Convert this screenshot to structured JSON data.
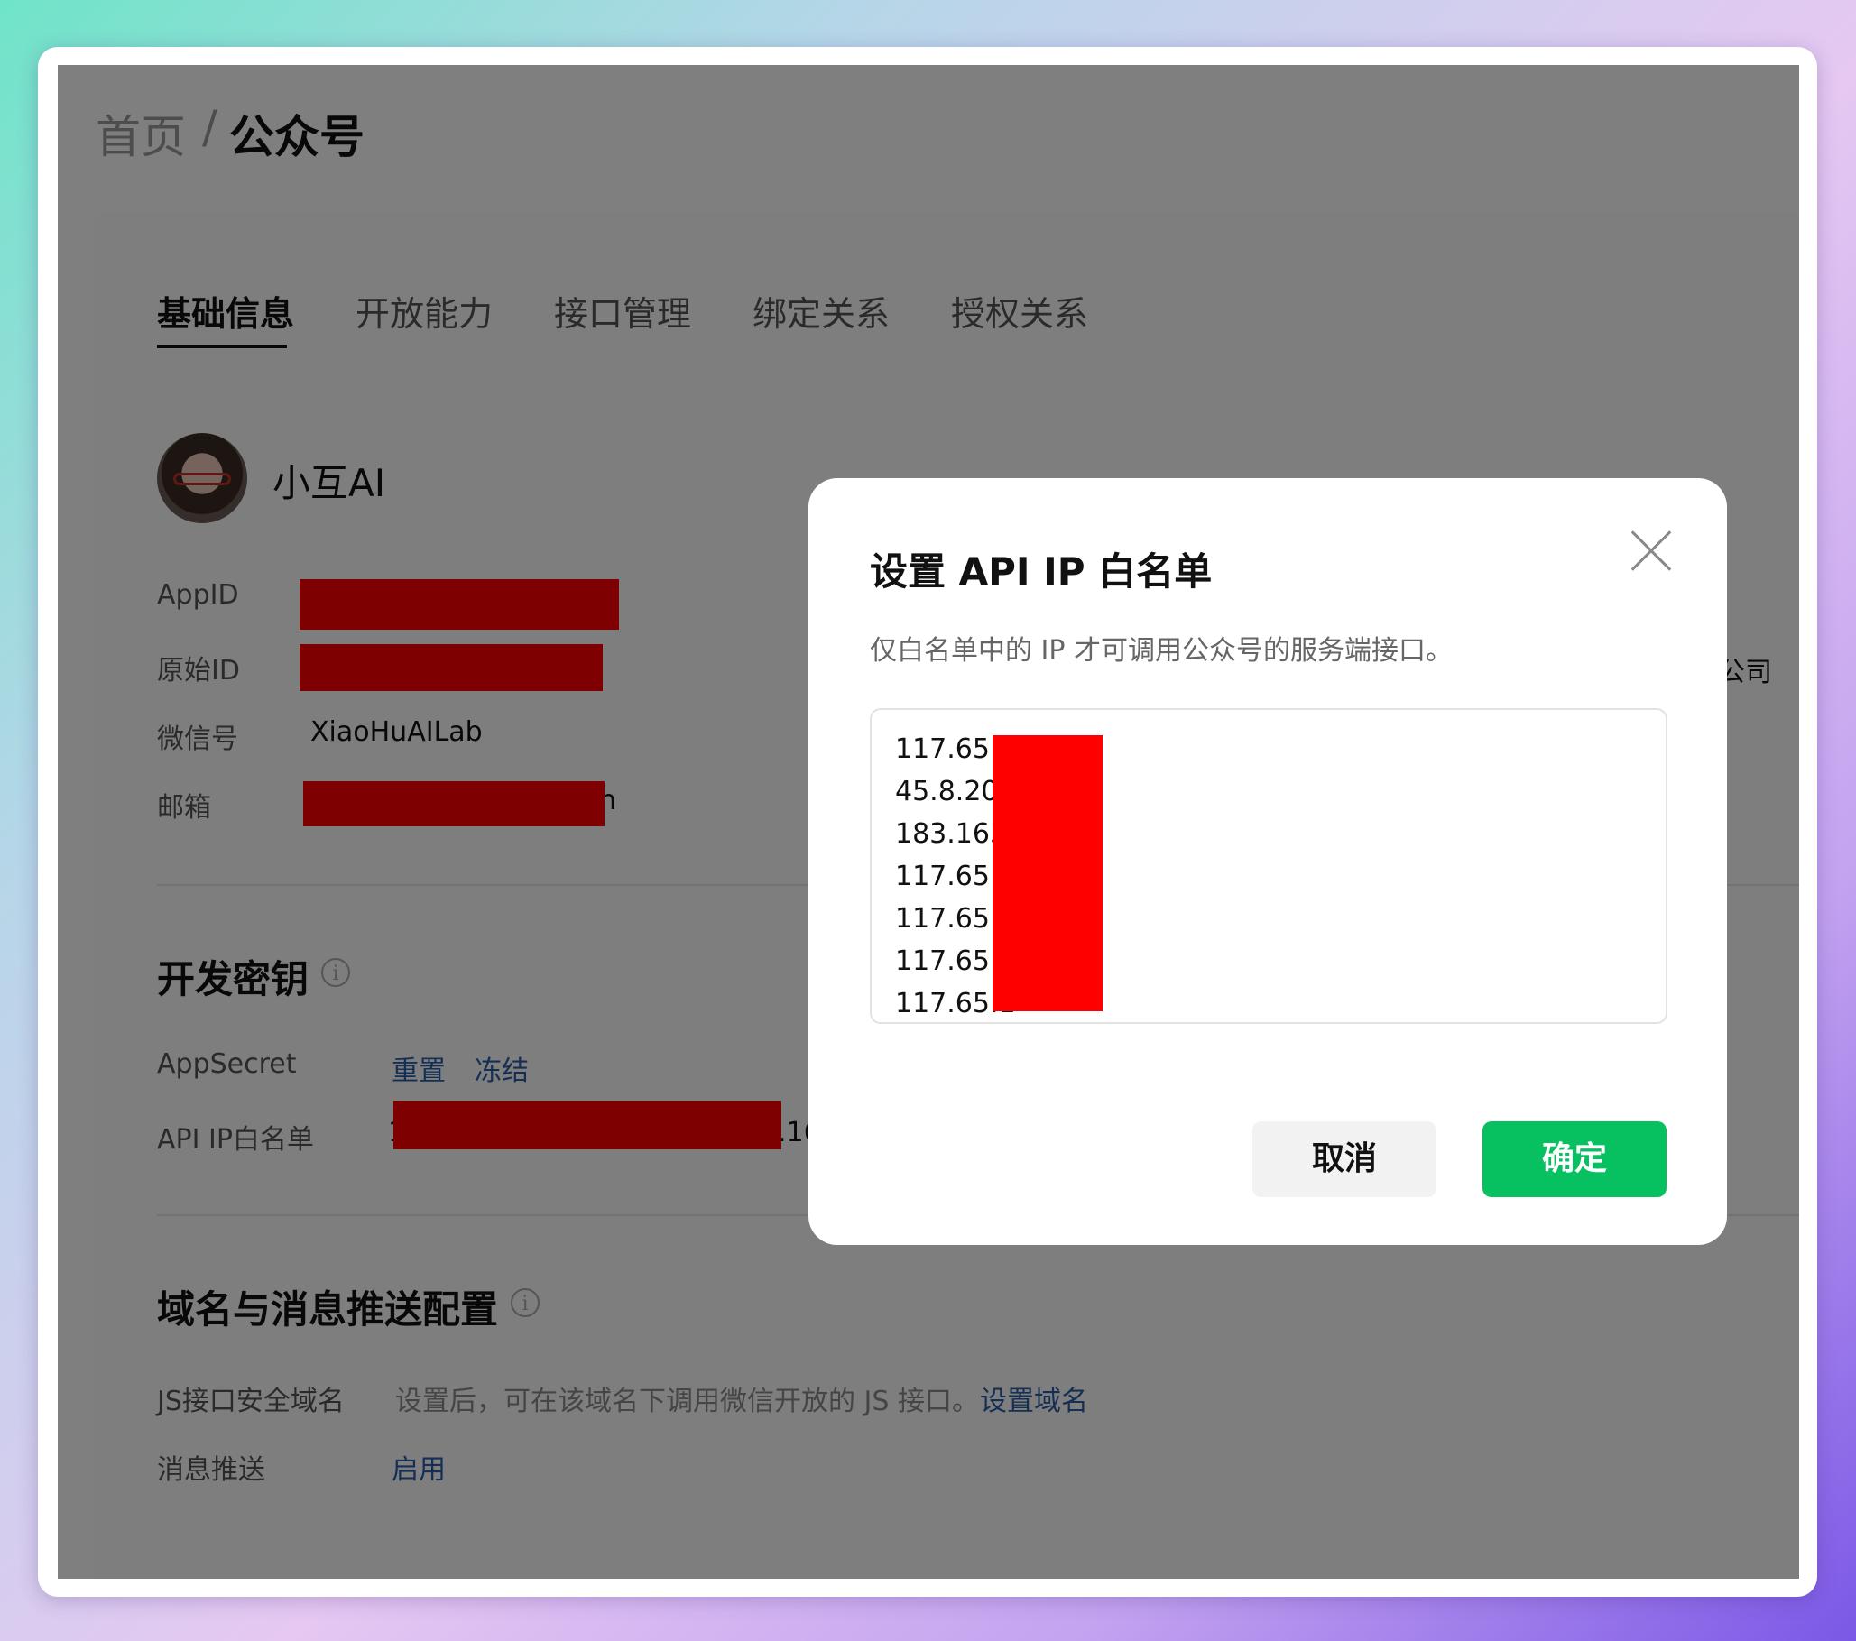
{
  "breadcrumb": {
    "home": "首页",
    "separator": "/",
    "current": "公众号"
  },
  "tabs": [
    "基础信息",
    "开放能力",
    "接口管理",
    "绑定关系",
    "授权关系"
  ],
  "account": {
    "name": "小互AI",
    "appid_label": "AppID",
    "original_id_label": "原始ID",
    "wechat_label": "微信号",
    "wechat_value": "XiaoHuAILab",
    "email_label": "邮箱",
    "email_tail": "n",
    "company_partial": "公司"
  },
  "dev_keys": {
    "title": "开发密钥",
    "appsecret_label": "AppSecret",
    "reset_label": "重置",
    "freeze_label": "冻结",
    "whitelist_label": "API IP白名单",
    "whitelist_head": "1",
    "whitelist_tail": ".16"
  },
  "domain_section": {
    "title": "域名与消息推送配置",
    "js_label": "JS接口安全域名",
    "js_desc": "设置后，可在该域名下调用微信开放的 JS 接口。",
    "js_link": "设置域名",
    "push_label": "消息推送",
    "push_link": "启用"
  },
  "modal": {
    "title": "设置 API IP 白名单",
    "description": "仅白名单中的 IP 才可调用公众号的服务端接口。",
    "ip_lines": [
      "117.65.1",
      "45.8.20",
      "183.163",
      "117.65.1",
      "117.65.1",
      "117.65.1",
      "117.65.1"
    ],
    "cancel_label": "取消",
    "confirm_label": "确定"
  },
  "colors": {
    "accent_green": "#07c160",
    "link_blue": "#2b5fa8",
    "redaction": "#ff0000"
  },
  "icons": {
    "close": "close-icon",
    "info": "info-icon"
  }
}
